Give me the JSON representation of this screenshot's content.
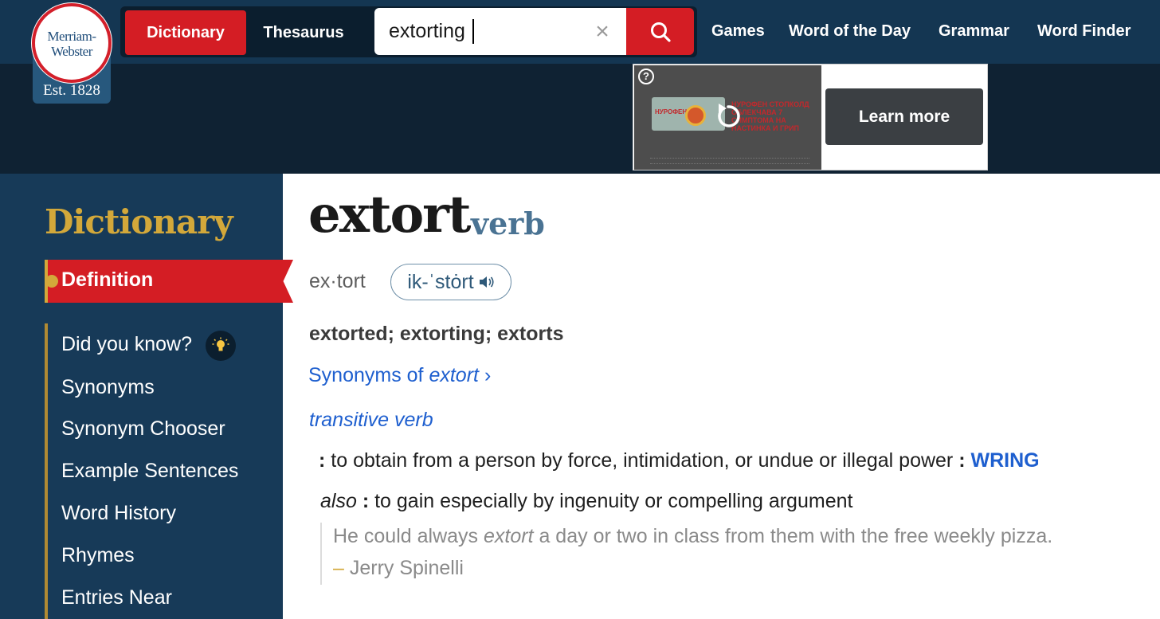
{
  "header": {
    "logo": {
      "line1": "Merriam-",
      "line2": "Webster",
      "est": "Est. 1828"
    },
    "tabs": {
      "dictionary": "Dictionary",
      "thesaurus": "Thesaurus"
    },
    "search": {
      "value": "extorting"
    },
    "nav": [
      "Games",
      "Word of the Day",
      "Grammar",
      "Word Finder"
    ],
    "colors": {
      "brand_red": "#d41d24",
      "navy": "#143652",
      "gold": "#d3a83a"
    }
  },
  "ad": {
    "product_label": "НУРОФЕН",
    "headline": "НУРОФЕН СТОПКОЛД ОБЛЕКЧАВА 7 СИМПТОМА НА НАСТИНКА И ГРИП",
    "cta": "Learn more"
  },
  "sidebar": {
    "heading": "Dictionary",
    "active_item": "Definition",
    "items": [
      "Did you know?",
      "Synonyms",
      "Synonym Chooser",
      "Example Sentences",
      "Word History",
      "Rhymes",
      "Entries Near"
    ]
  },
  "entry": {
    "headword": "extort",
    "part_of_speech": "verb",
    "syllables": "ex·tort",
    "pronunciation": "ik-ˈstȯrt",
    "inflections": "extorted; extorting; extorts",
    "synonyms_link": {
      "prefix": "Synonyms of ",
      "word": "extort",
      "chevron": "›"
    },
    "sense_label": "transitive verb",
    "definition_1": {
      "colon": ":",
      "text": " to obtain from a person by force, intimidation, or undue or illegal power ",
      "xref": "WRING"
    },
    "definition_2": {
      "label": "also",
      "colon": ":",
      "text": " to gain especially by ingenuity or compelling argument"
    },
    "example": {
      "before": "He could always ",
      "italic": "extort",
      "after": " a day or two in class from them with the free weekly pizza.",
      "dash": "–",
      "author": " Jerry Spinelli"
    }
  }
}
